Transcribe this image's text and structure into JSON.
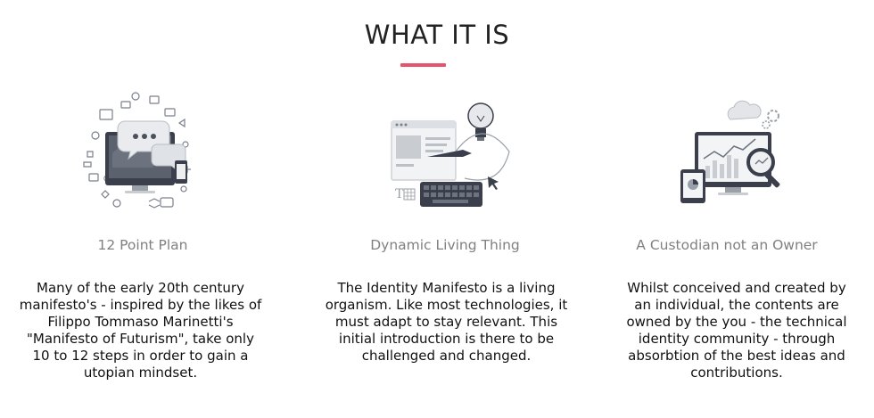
{
  "section": {
    "title": "WHAT IT IS",
    "accent_color": "#e5546b"
  },
  "features": [
    {
      "icon": "social-media-chat-icon",
      "heading": "12 Point Plan",
      "body": "Many of the early 20th century manifesto's - inspired by the likes of Filippo Tommaso Marinetti's \"Manifesto of Futurism\", take only 10 to 12 steps in order to gain a utopian mindset."
    },
    {
      "icon": "design-lightbulb-keyboard-icon",
      "heading": "Dynamic Living Thing",
      "body": "The Identity Manifesto is a living organism. Like most technologies, it must adapt to stay relevant. This initial introduction is there to be challenged and changed."
    },
    {
      "icon": "analytics-magnifier-cloud-icon",
      "heading": "A Custodian not an Owner",
      "body": "Whilst conceived and created by an individual, the contents are owned by the you - the technical identity community - through absorbtion of the best ideas and contributions."
    }
  ]
}
